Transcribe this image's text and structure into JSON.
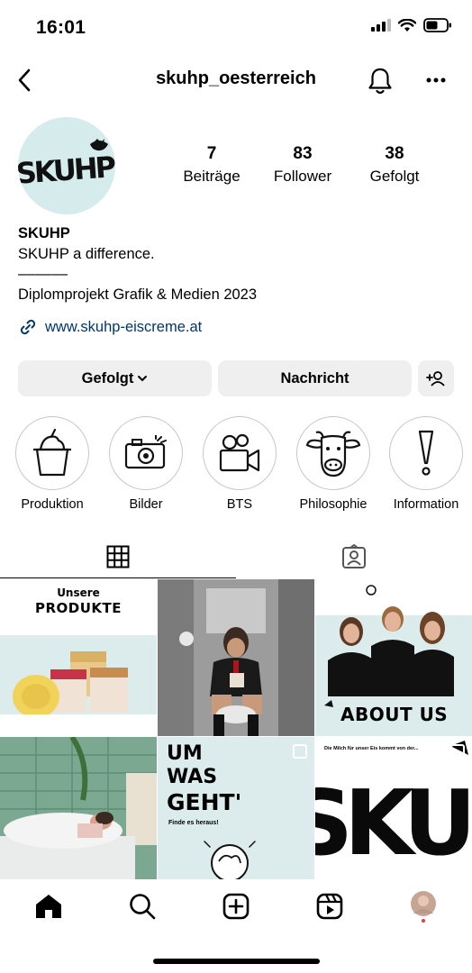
{
  "status_bar": {
    "time": "16:01"
  },
  "nav": {
    "username": "skuhp_oesterreich"
  },
  "profile": {
    "avatar_text": "SKUHP",
    "stats": [
      {
        "value": "7",
        "label": "Beiträge"
      },
      {
        "value": "83",
        "label": "Follower"
      },
      {
        "value": "38",
        "label": "Gefolgt"
      }
    ],
    "bio": {
      "name": "SKUHP",
      "line1": "SKUHP a difference.",
      "line2": "––––––",
      "line3": "Diplomprojekt Grafik & Medien 2023",
      "link": "www.skuhp-eiscreme.at"
    }
  },
  "actions": {
    "follow_label": "Gefolgt",
    "message_label": "Nachricht"
  },
  "highlights": [
    {
      "label": "Produktion",
      "icon": "ice-cream-cup-icon"
    },
    {
      "label": "Bilder",
      "icon": "camera-icon"
    },
    {
      "label": "BTS",
      "icon": "video-camera-icon"
    },
    {
      "label": "Philosophie",
      "icon": "cow-icon"
    },
    {
      "label": "Information",
      "icon": "exclamation-icon"
    }
  ],
  "posts": [
    {
      "line1": "Unsere",
      "line2": "PRODUKTE"
    },
    {
      "caption": ""
    },
    {
      "line1": "ABOUT US"
    },
    {
      "caption": ""
    },
    {
      "line1": "UM",
      "line2": "WAS",
      "line3": "GEHT'",
      "line4": "Finde es heraus!"
    },
    {
      "line1": "Die Milch für unser Eis kommt von der...",
      "line2": "SKUHP"
    }
  ],
  "colors": {
    "accent_link": "#00376b",
    "button_bg": "#efefef",
    "brand_mint": "#d6ecec"
  }
}
